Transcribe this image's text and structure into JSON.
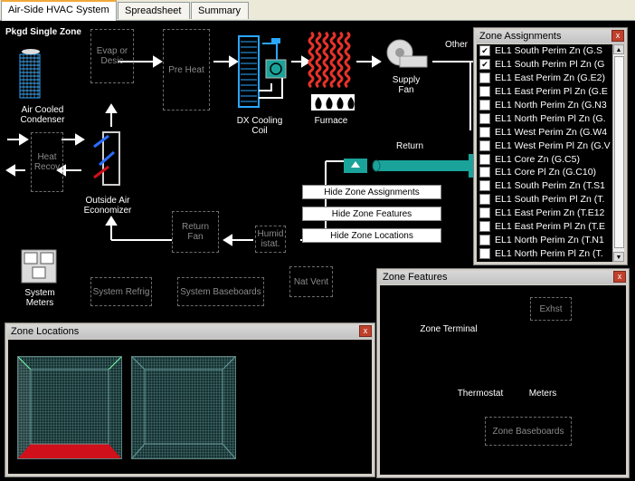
{
  "tabs": [
    {
      "label": "Air-Side HVAC System"
    },
    {
      "label": "Spreadsheet"
    },
    {
      "label": "Summary"
    }
  ],
  "diagram": {
    "title": "Pkgd Single Zone",
    "condenser": "Air Cooled Condenser",
    "evap_desic": "Evap or Desic",
    "pre_heat": "Pre Heat",
    "dx_cooling": "DX Cooling Coil",
    "furnace": "Furnace",
    "supply_fan": "Supply Fan",
    "other": "Other",
    "return": "Return",
    "heat_recov": "Heat Recov",
    "economizer": "Outside Air Economizer",
    "return_fan": "Return Fan",
    "humidistat": "Humid istat.",
    "system_meters": "System Meters",
    "system_refrig": "System Refrig",
    "system_baseboards": "System Baseboards",
    "nat_vent": "Nat Vent"
  },
  "buttons": {
    "hide_zone_assignments": "Hide Zone Assignments",
    "hide_zone_features": "Hide Zone Features",
    "hide_zone_locations": "Hide Zone Locations"
  },
  "zone_assignments": {
    "title": "Zone Assignments",
    "close": "x",
    "items": [
      {
        "label": "EL1 South Perim Zn (G.S",
        "checked": true
      },
      {
        "label": "EL1 South Perim Pl Zn (G",
        "checked": true
      },
      {
        "label": "EL1 East Perim Zn (G.E2)",
        "checked": false
      },
      {
        "label": "EL1 East Perim Pl Zn (G.E",
        "checked": false
      },
      {
        "label": "EL1 North Perim Zn (G.N3",
        "checked": false
      },
      {
        "label": "EL1 North Perim Pl Zn (G.",
        "checked": false
      },
      {
        "label": "EL1 West Perim Zn (G.W4",
        "checked": false
      },
      {
        "label": "EL1 West Perim Pl Zn (G.V",
        "checked": false
      },
      {
        "label": "EL1 Core Zn (G.C5)",
        "checked": false
      },
      {
        "label": "EL1 Core Pl Zn (G.C10)",
        "checked": false
      },
      {
        "label": "EL1 South Perim Zn (T.S1",
        "checked": false
      },
      {
        "label": "EL1 South Perim Pl Zn (T.",
        "checked": false
      },
      {
        "label": "EL1 East Perim Zn (T.E12",
        "checked": false
      },
      {
        "label": "EL1 East Perim Pl Zn (T.E",
        "checked": false
      },
      {
        "label": "EL1 North Perim Zn (T.N1",
        "checked": false
      },
      {
        "label": "EL1 North Perim Pl Zn (T.",
        "checked": false
      }
    ]
  },
  "zone_locations": {
    "title": "Zone Locations",
    "close": "x"
  },
  "zone_features": {
    "title": "Zone Features",
    "close": "x",
    "terminal": "Zone Terminal",
    "exhst": "Exhst",
    "thermostat": "Thermostat",
    "meters": "Meters",
    "baseboards": "Zone Baseboards"
  },
  "colors": {
    "accent_tab": "#f1a93a",
    "duct": "#1aa39a",
    "zone_selected": "#d0101a",
    "coil_blue": "#2aa7ff",
    "furnace_red": "#e8322a"
  }
}
